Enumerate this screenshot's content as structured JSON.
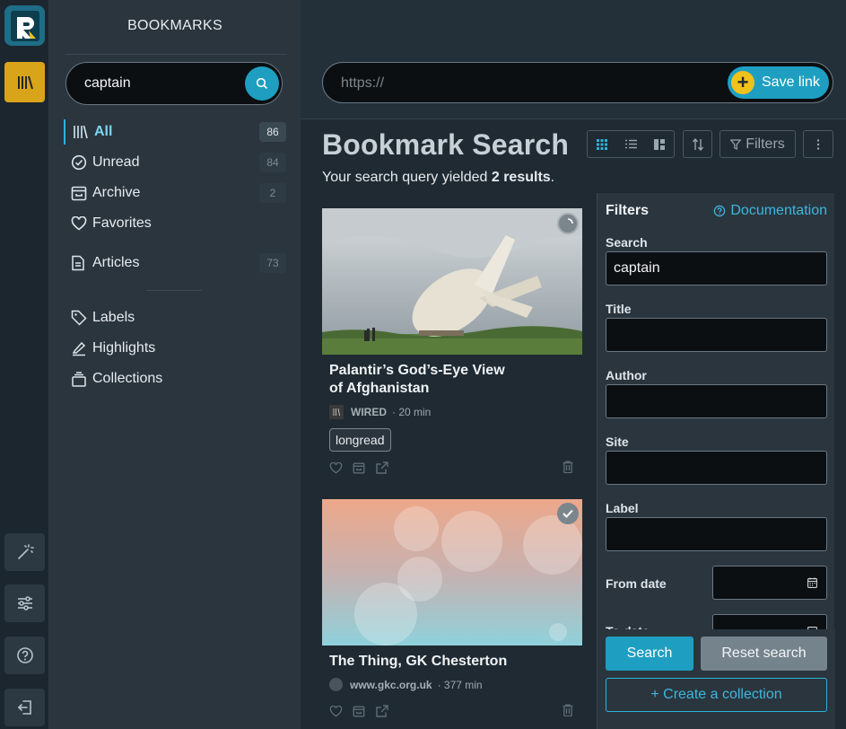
{
  "sidebar": {
    "title": "BOOKMARKS",
    "search_value": "captain",
    "items": [
      {
        "label": "All",
        "count": "86"
      },
      {
        "label": "Unread",
        "count": "84"
      },
      {
        "label": "Archive",
        "count": "2"
      },
      {
        "label": "Favorites",
        "count": ""
      },
      {
        "label": "Articles",
        "count": "73"
      }
    ],
    "extra": [
      {
        "label": "Labels"
      },
      {
        "label": "Highlights"
      },
      {
        "label": "Collections"
      }
    ]
  },
  "topbar": {
    "url_placeholder": "https://",
    "save_label": "Save link"
  },
  "main": {
    "title": "Bookmark Search",
    "result_prefix": "Your search query yielded ",
    "result_count": "2 results",
    "result_suffix": ".",
    "filters_button": "Filters"
  },
  "cards": [
    {
      "title": "Palantir’s God’s-Eye View of Afghanistan",
      "site": "WIRED",
      "reading_time": "· 20 min",
      "tag": "longread"
    },
    {
      "title": "The Thing, GK Chesterton",
      "site": "www.gkc.org.uk",
      "reading_time": "· 377 min"
    }
  ],
  "filters": {
    "heading": "Filters",
    "documentation": "Documentation",
    "search_label": "Search",
    "search_value": "captain",
    "title_label": "Title",
    "author_label": "Author",
    "site_label": "Site",
    "label_label": "Label",
    "from_date_label": "From date",
    "to_date_label": "To date",
    "search_button": "Search",
    "reset_button": "Reset search",
    "create_collection": "+ Create a collection"
  },
  "colors": {
    "accent": "#1e9fc2",
    "active_rail": "#d8a51a",
    "save_plus": "#f1c21b"
  }
}
